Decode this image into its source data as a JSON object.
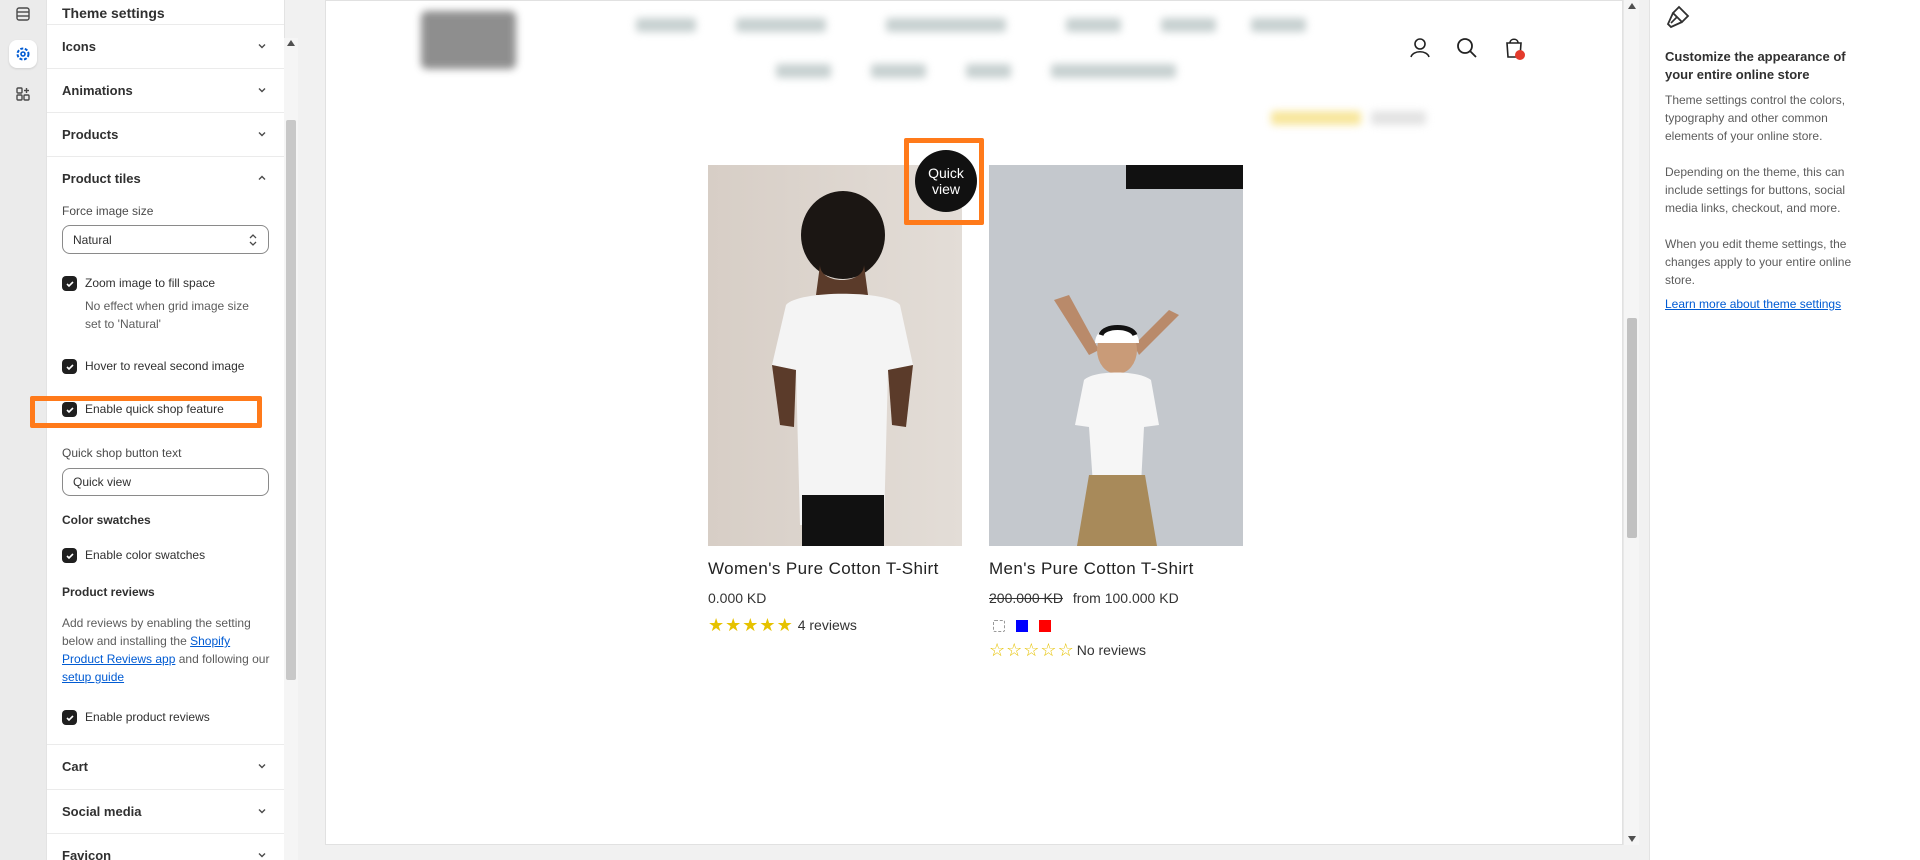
{
  "settings_panel": {
    "title": "Theme settings",
    "sections_top": [
      {
        "label": "Icons"
      },
      {
        "label": "Animations"
      },
      {
        "label": "Products"
      }
    ],
    "product_tiles": {
      "label": "Product tiles",
      "force_image_size_label": "Force image size",
      "force_image_size_value": "Natural",
      "zoom_label": "Zoom image to fill space",
      "zoom_help": "No effect when grid image size set to 'Natural'",
      "hover_label": "Hover to reveal second image",
      "quick_shop_label": "Enable quick shop feature",
      "quick_shop_text_label": "Quick shop button text",
      "quick_shop_text_value": "Quick view",
      "color_swatches_heading": "Color swatches",
      "color_swatches_label": "Enable color swatches",
      "product_reviews_heading": "Product reviews",
      "reviews_para_1": "Add reviews by enabling the setting below and installing the",
      "reviews_link_1": "Shopify Product Reviews app",
      "reviews_para_2": "and following our",
      "reviews_link_2": "setup guide",
      "reviews_label": "Enable product reviews"
    },
    "sections_bottom": [
      {
        "label": "Cart"
      },
      {
        "label": "Social media"
      },
      {
        "label": "Favicon"
      }
    ]
  },
  "preview": {
    "products": [
      {
        "title": "Women's Pure Cotton T-Shirt",
        "price": "0.000 KD",
        "rating_stars": 5,
        "reviews": "4 reviews",
        "quick_view": "Quick view"
      },
      {
        "title": "Men's Pure Cotton T-Shirt",
        "compare_price": "200.000 KD",
        "price": "from 100.000 KD",
        "swatches": [
          "#ffffff",
          "#0000ff",
          "#ff0000"
        ],
        "rating_stars": 0,
        "reviews": "No reviews"
      }
    ]
  },
  "help_panel": {
    "heading": "Customize the appearance of your entire online store",
    "para_1": "Theme settings control the colors, typography and other common elements of your online store.",
    "para_2": "Depending on the theme, this can include settings for buttons, social media links, checkout, and more.",
    "para_3": "When you edit theme settings, the changes apply to your entire online store.",
    "link": "Learn more about theme settings"
  },
  "colors": {
    "highlight": "#ff7a1a",
    "link": "#005bd3",
    "star": "#e6c200",
    "cart_badge": "#e43b2c"
  }
}
